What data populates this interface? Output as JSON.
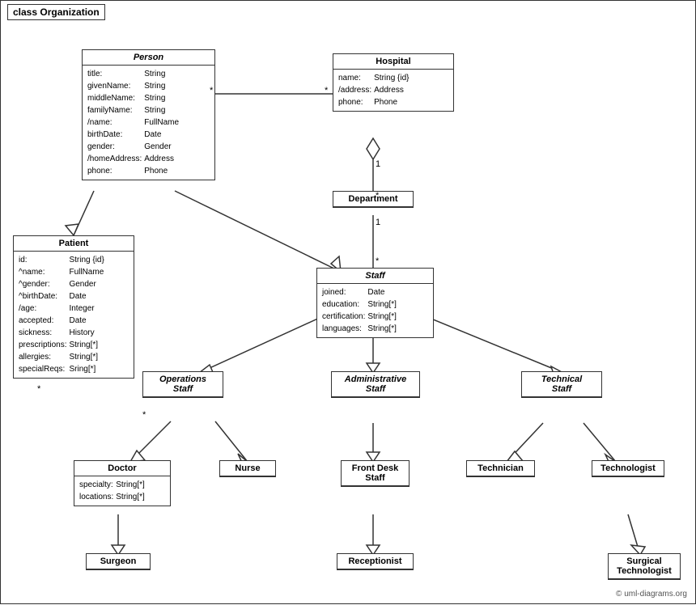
{
  "title": "class Organization",
  "copyright": "© uml-diagrams.org",
  "classes": {
    "person": {
      "name": "Person",
      "italic": true,
      "attrs": [
        [
          "title:",
          "String"
        ],
        [
          "givenName:",
          "String"
        ],
        [
          "middleName:",
          "String"
        ],
        [
          "familyName:",
          "String"
        ],
        [
          "/name:",
          "FullName"
        ],
        [
          "birthDate:",
          "Date"
        ],
        [
          "gender:",
          "Gender"
        ],
        [
          "/homeAddress:",
          "Address"
        ],
        [
          "phone:",
          "Phone"
        ]
      ]
    },
    "hospital": {
      "name": "Hospital",
      "italic": false,
      "attrs": [
        [
          "name:",
          "String {id}"
        ],
        [
          "/address:",
          "Address"
        ],
        [
          "phone:",
          "Phone"
        ]
      ]
    },
    "patient": {
      "name": "Patient",
      "italic": false,
      "attrs": [
        [
          "id:",
          "String {id}"
        ],
        [
          "^name:",
          "FullName"
        ],
        [
          "^gender:",
          "Gender"
        ],
        [
          "^birthDate:",
          "Date"
        ],
        [
          "/age:",
          "Integer"
        ],
        [
          "accepted:",
          "Date"
        ],
        [
          "sickness:",
          "History"
        ],
        [
          "prescriptions:",
          "String[*]"
        ],
        [
          "allergies:",
          "String[*]"
        ],
        [
          "specialReqs:",
          "Sring[*]"
        ]
      ]
    },
    "department": {
      "name": "Department",
      "italic": false,
      "attrs": []
    },
    "staff": {
      "name": "Staff",
      "italic": true,
      "attrs": [
        [
          "joined:",
          "Date"
        ],
        [
          "education:",
          "String[*]"
        ],
        [
          "certification:",
          "String[*]"
        ],
        [
          "languages:",
          "String[*]"
        ]
      ]
    },
    "operations_staff": {
      "name": "Operations\nStaff",
      "italic": true,
      "attrs": []
    },
    "administrative_staff": {
      "name": "Administrative\nStaff",
      "italic": true,
      "attrs": []
    },
    "technical_staff": {
      "name": "Technical\nStaff",
      "italic": true,
      "attrs": []
    },
    "doctor": {
      "name": "Doctor",
      "italic": false,
      "attrs": [
        [
          "specialty:",
          "String[*]"
        ],
        [
          "locations:",
          "String[*]"
        ]
      ]
    },
    "nurse": {
      "name": "Nurse",
      "italic": false,
      "attrs": []
    },
    "front_desk_staff": {
      "name": "Front Desk\nStaff",
      "italic": false,
      "attrs": []
    },
    "technician": {
      "name": "Technician",
      "italic": false,
      "attrs": []
    },
    "technologist": {
      "name": "Technologist",
      "italic": false,
      "attrs": []
    },
    "surgeon": {
      "name": "Surgeon",
      "italic": false,
      "attrs": []
    },
    "receptionist": {
      "name": "Receptionist",
      "italic": false,
      "attrs": []
    },
    "surgical_technologist": {
      "name": "Surgical\nTechnologist",
      "italic": false,
      "attrs": []
    }
  }
}
